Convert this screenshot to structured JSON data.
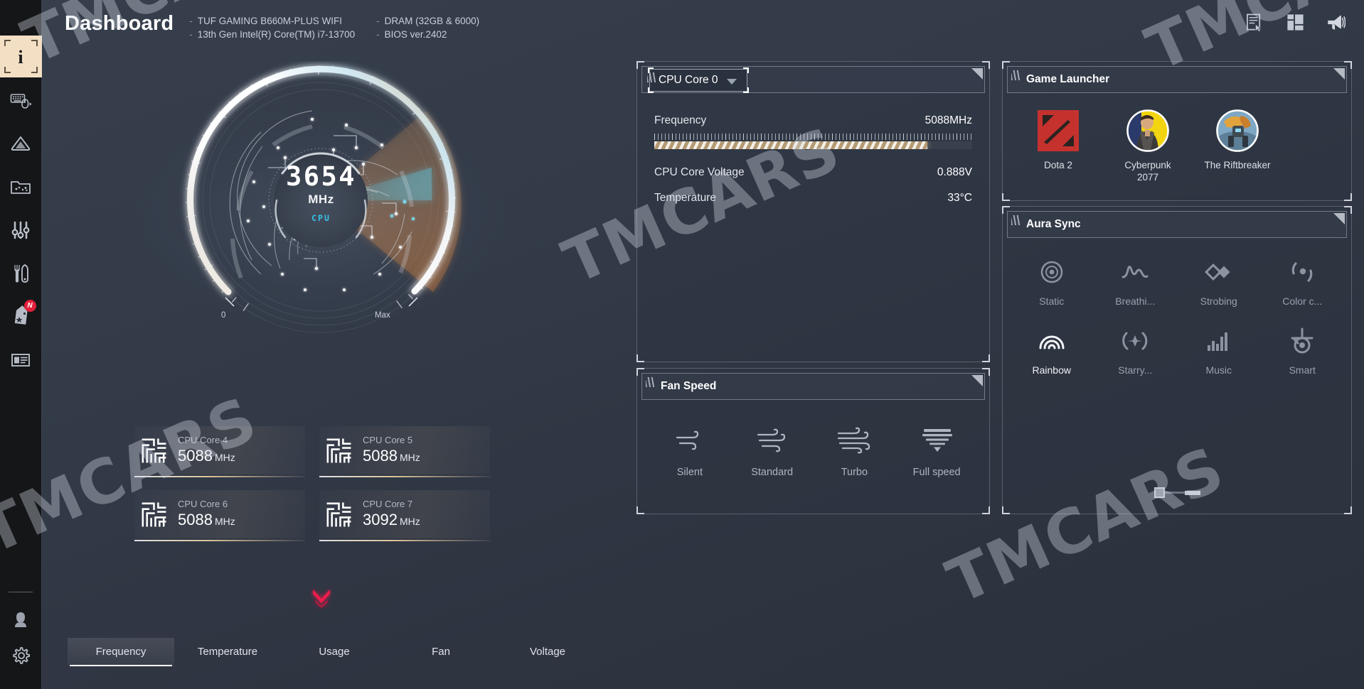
{
  "header": {
    "title": "Dashboard",
    "sysinfo_col1": [
      "TUF GAMING B660M-PLUS WIFI",
      "13th Gen Intel(R) Core(TM) i7-13700"
    ],
    "sysinfo_col2": [
      "DRAM (32GB & 6000)",
      "BIOS ver.2402"
    ],
    "actions": [
      {
        "name": "report-icon",
        "label": "Report"
      },
      {
        "name": "layout-icon",
        "label": "Layout"
      },
      {
        "name": "megaphone-icon",
        "label": "Announcements"
      }
    ]
  },
  "sidebar": {
    "items": [
      {
        "name": "info-icon",
        "label": "Information",
        "selected": true,
        "badge": ""
      },
      {
        "name": "keyboard-mouse-icon",
        "label": "Input Devices",
        "selected": false,
        "badge": ""
      },
      {
        "name": "ai-suite-icon",
        "label": "AI Suite",
        "selected": false,
        "badge": ""
      },
      {
        "name": "game-folder-icon",
        "label": "Game Folder",
        "selected": false,
        "badge": ""
      },
      {
        "name": "sliders-icon",
        "label": "Tuning",
        "selected": false,
        "badge": ""
      },
      {
        "name": "tools-icon",
        "label": "Tools",
        "selected": false,
        "badge": ""
      },
      {
        "name": "tag-icon",
        "label": "Offers",
        "selected": false,
        "badge": "N"
      },
      {
        "name": "news-card-icon",
        "label": "News",
        "selected": false,
        "badge": ""
      }
    ],
    "bottom_items": [
      {
        "name": "user-icon",
        "label": "Account"
      },
      {
        "name": "gear-icon",
        "label": "Settings"
      }
    ]
  },
  "gauge": {
    "value": "3654",
    "unit": "MHz",
    "label": "CPU",
    "min_label": "0",
    "max_label": "Max"
  },
  "cores": [
    {
      "name": "CPU Core 4",
      "value": "5088",
      "unit": "MHz"
    },
    {
      "name": "CPU Core 5",
      "value": "5088",
      "unit": "MHz"
    },
    {
      "name": "CPU Core 6",
      "value": "5088",
      "unit": "MHz"
    },
    {
      "name": "CPU Core 7",
      "value": "3092",
      "unit": "MHz"
    }
  ],
  "tabs": [
    {
      "label": "Frequency",
      "active": true
    },
    {
      "label": "Temperature",
      "active": false
    },
    {
      "label": "Usage",
      "active": false
    },
    {
      "label": "Fan",
      "active": false
    },
    {
      "label": "Voltage",
      "active": false
    }
  ],
  "cpu_panel": {
    "selected_core": "CPU Core 0",
    "metrics": [
      {
        "label": "Frequency",
        "value": "5088MHz"
      },
      {
        "label": "CPU Core Voltage",
        "value": "0.888V"
      },
      {
        "label": "Temperature",
        "value": "33°C"
      }
    ],
    "frequency_bar_percent": 86
  },
  "fan_panel": {
    "title": "Fan Speed",
    "modes": [
      {
        "label": "Silent",
        "icon": "wind-light-icon"
      },
      {
        "label": "Standard",
        "icon": "wind-medium-icon"
      },
      {
        "label": "Turbo",
        "icon": "wind-strong-icon"
      },
      {
        "label": "Full speed",
        "icon": "wind-full-icon"
      }
    ]
  },
  "game_launcher": {
    "title": "Game Launcher",
    "games": [
      {
        "name": "Dota 2",
        "icon": "dota2-icon"
      },
      {
        "name": "Cyberpunk 2077",
        "icon": "cyberpunk-icon"
      },
      {
        "name": "The Riftbreaker",
        "icon": "riftbreaker-icon"
      }
    ]
  },
  "aura_sync": {
    "title": "Aura Sync",
    "effects": [
      {
        "label": "Static",
        "icon": "static-icon",
        "active": false
      },
      {
        "label": "Breathi...",
        "icon": "breathing-icon",
        "active": false
      },
      {
        "label": "Strobing",
        "icon": "strobing-icon",
        "active": false
      },
      {
        "label": "Color c...",
        "icon": "color-cycle-icon",
        "active": false
      },
      {
        "label": "Rainbow",
        "icon": "rainbow-icon",
        "active": true
      },
      {
        "label": "Starry...",
        "icon": "starry-night-icon",
        "active": false
      },
      {
        "label": "Music",
        "icon": "music-icon",
        "active": false
      },
      {
        "label": "Smart",
        "icon": "smart-icon",
        "active": false
      }
    ]
  },
  "watermark": {
    "text": "TMCARS"
  },
  "colors": {
    "accent_cyan": "#37c3ea",
    "accent_gold": "#b49a74",
    "badge_red": "#e0203c",
    "selected_cream": "#f3dfc4",
    "panel_bg": "#2e3542",
    "app_bg": "#333b49"
  }
}
